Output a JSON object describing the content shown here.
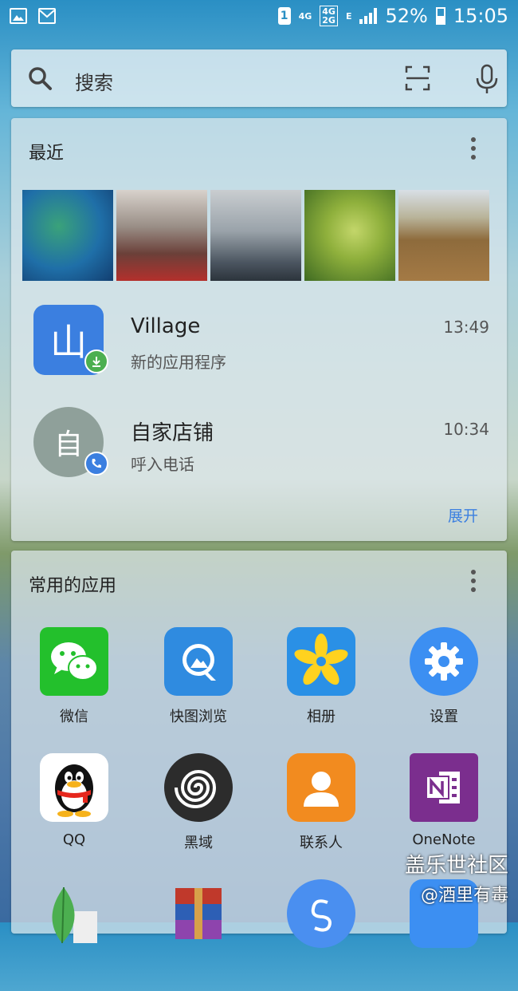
{
  "status_bar": {
    "sim_slot": "1",
    "network_1": "4G",
    "network_2_top": "4G",
    "network_2_bottom": "2G",
    "network_3": "E",
    "battery": "52%",
    "time": "15:05"
  },
  "search": {
    "placeholder": "搜索"
  },
  "recent": {
    "title": "最近",
    "items": [
      {
        "title": "Village",
        "subtitle": "新的应用程序",
        "time": "13:49",
        "icon_char": "山"
      },
      {
        "title": "自家店铺",
        "subtitle": "呼入电话",
        "time": "10:34",
        "icon_char": "自"
      }
    ],
    "expand_label": "展开"
  },
  "apps": {
    "title": "常用的应用",
    "items": [
      {
        "label": "微信"
      },
      {
        "label": "快图浏览"
      },
      {
        "label": "相册"
      },
      {
        "label": "设置"
      },
      {
        "label": "QQ"
      },
      {
        "label": "黑域"
      },
      {
        "label": "联系人"
      },
      {
        "label": "OneNote"
      }
    ]
  },
  "watermark": {
    "line1": "盖乐世社区",
    "line2": "@酒里有毒"
  }
}
